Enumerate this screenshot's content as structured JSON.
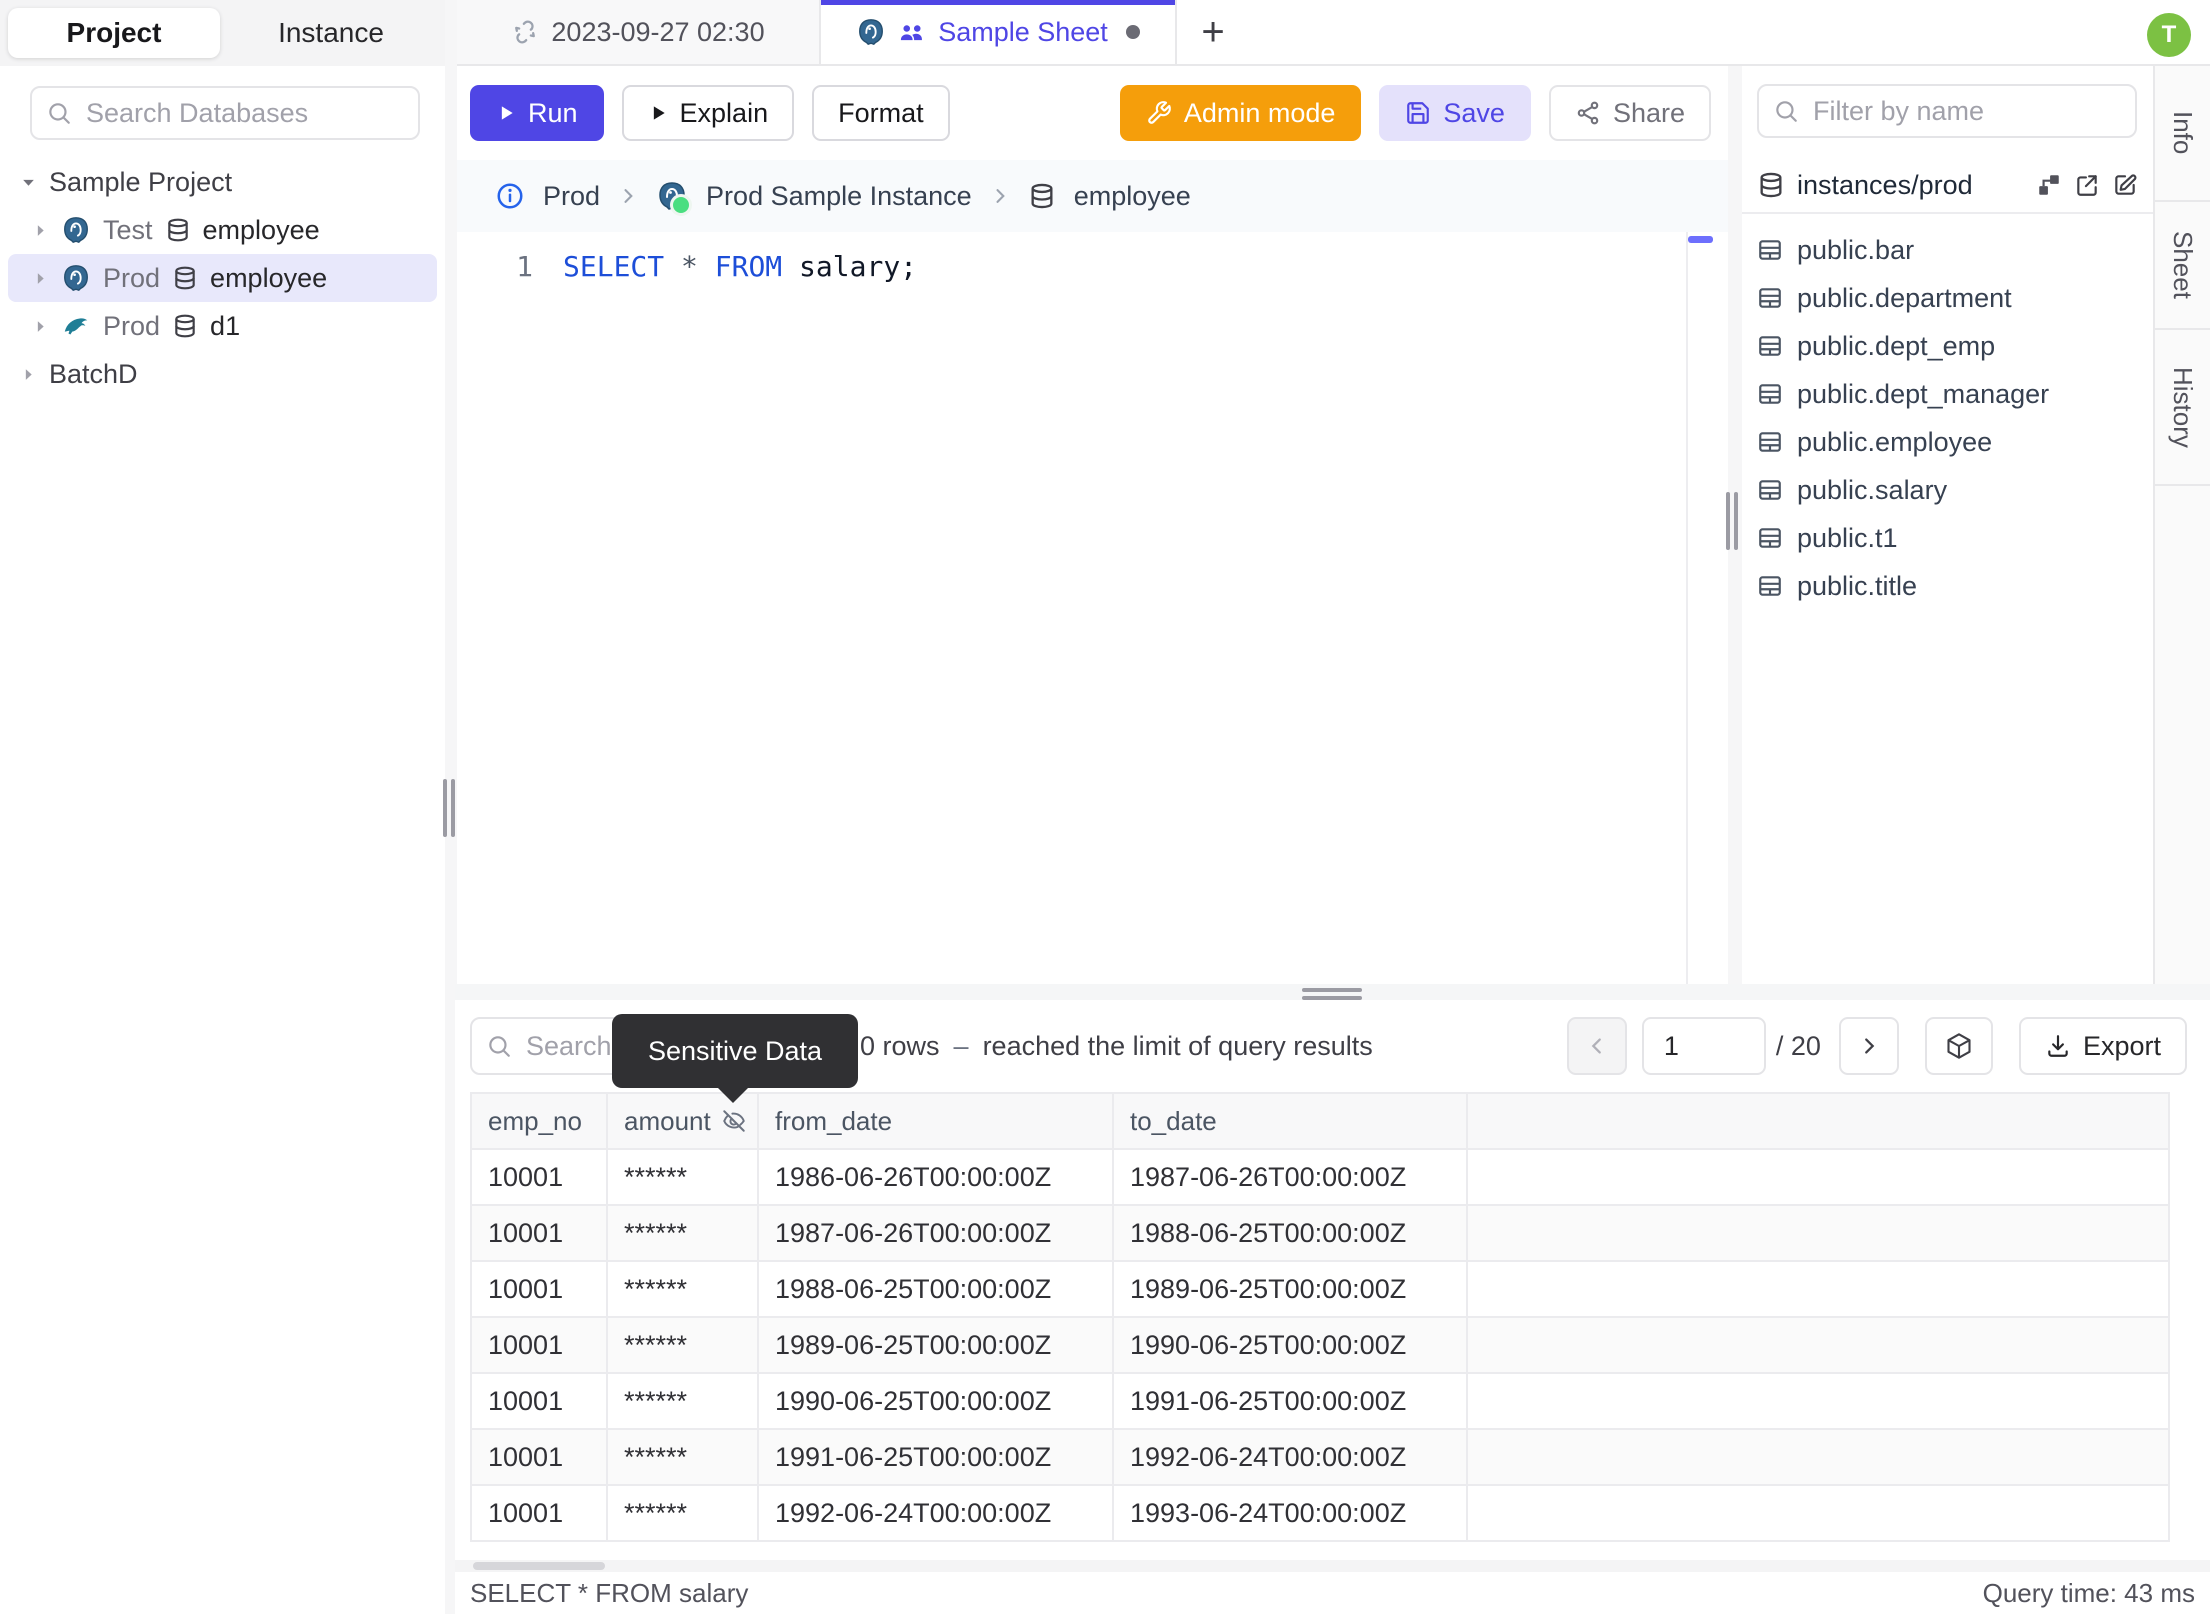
{
  "colors": {
    "accent": "#4f46e5",
    "admin_orange": "#f59e0b",
    "avatar_green": "#7cc143",
    "selection": "#e8e8fb",
    "keyword_blue": "#1d4ed8",
    "tooltip_bg": "#303033"
  },
  "sidebar": {
    "tabs": [
      "Project",
      "Instance"
    ],
    "search_placeholder": "Search Databases",
    "tree": {
      "root": "Sample Project",
      "databases": [
        {
          "env": "Test",
          "name": "employee",
          "engine": "postgres"
        },
        {
          "env": "Prod",
          "name": "employee",
          "engine": "postgres"
        },
        {
          "env": "Prod",
          "name": "d1",
          "engine": "mysql"
        }
      ],
      "collapsed_project": "BatchD"
    }
  },
  "tabs": {
    "history_tab": "2023-09-27 02:30",
    "sheet_tab": "Sample Sheet",
    "new_tab": "+"
  },
  "user": {
    "avatar_initial": "T"
  },
  "toolbar": {
    "run": "Run",
    "explain": "Explain",
    "format": "Format",
    "admin_mode": "Admin mode",
    "save": "Save",
    "share": "Share"
  },
  "breadcrumb": {
    "items": [
      "Prod",
      "Prod Sample Instance",
      "employee"
    ]
  },
  "editor": {
    "line_number": "1",
    "sql": {
      "kw1": "SELECT",
      "star": "*",
      "kw2": "FROM",
      "rest": "salary;"
    }
  },
  "schema_panel": {
    "filter_placeholder": "Filter by name",
    "instance": "instances/prod",
    "tables": [
      "public.bar",
      "public.department",
      "public.dept_emp",
      "public.dept_manager",
      "public.employee",
      "public.salary",
      "public.t1",
      "public.title"
    ]
  },
  "side_tabs": [
    "Info",
    "Sheet",
    "History"
  ],
  "results": {
    "search_placeholder": "Search",
    "tooltip": "Sensitive Data",
    "row_count": "0 rows",
    "dash": "–",
    "limit_note": "reached the limit of query results",
    "page": "1",
    "page_total": "/ 20",
    "export_label": "Export",
    "columns": [
      "emp_no",
      "amount",
      "from_date",
      "to_date"
    ],
    "rows": [
      [
        "10001",
        "******",
        "1986-06-26T00:00:00Z",
        "1987-06-26T00:00:00Z"
      ],
      [
        "10001",
        "******",
        "1987-06-26T00:00:00Z",
        "1988-06-25T00:00:00Z"
      ],
      [
        "10001",
        "******",
        "1988-06-25T00:00:00Z",
        "1989-06-25T00:00:00Z"
      ],
      [
        "10001",
        "******",
        "1989-06-25T00:00:00Z",
        "1990-06-25T00:00:00Z"
      ],
      [
        "10001",
        "******",
        "1990-06-25T00:00:00Z",
        "1991-06-25T00:00:00Z"
      ],
      [
        "10001",
        "******",
        "1991-06-25T00:00:00Z",
        "1992-06-24T00:00:00Z"
      ],
      [
        "10001",
        "******",
        "1992-06-24T00:00:00Z",
        "1993-06-24T00:00:00Z"
      ]
    ],
    "statement": "SELECT * FROM salary",
    "query_time": "Query time: 43 ms"
  }
}
